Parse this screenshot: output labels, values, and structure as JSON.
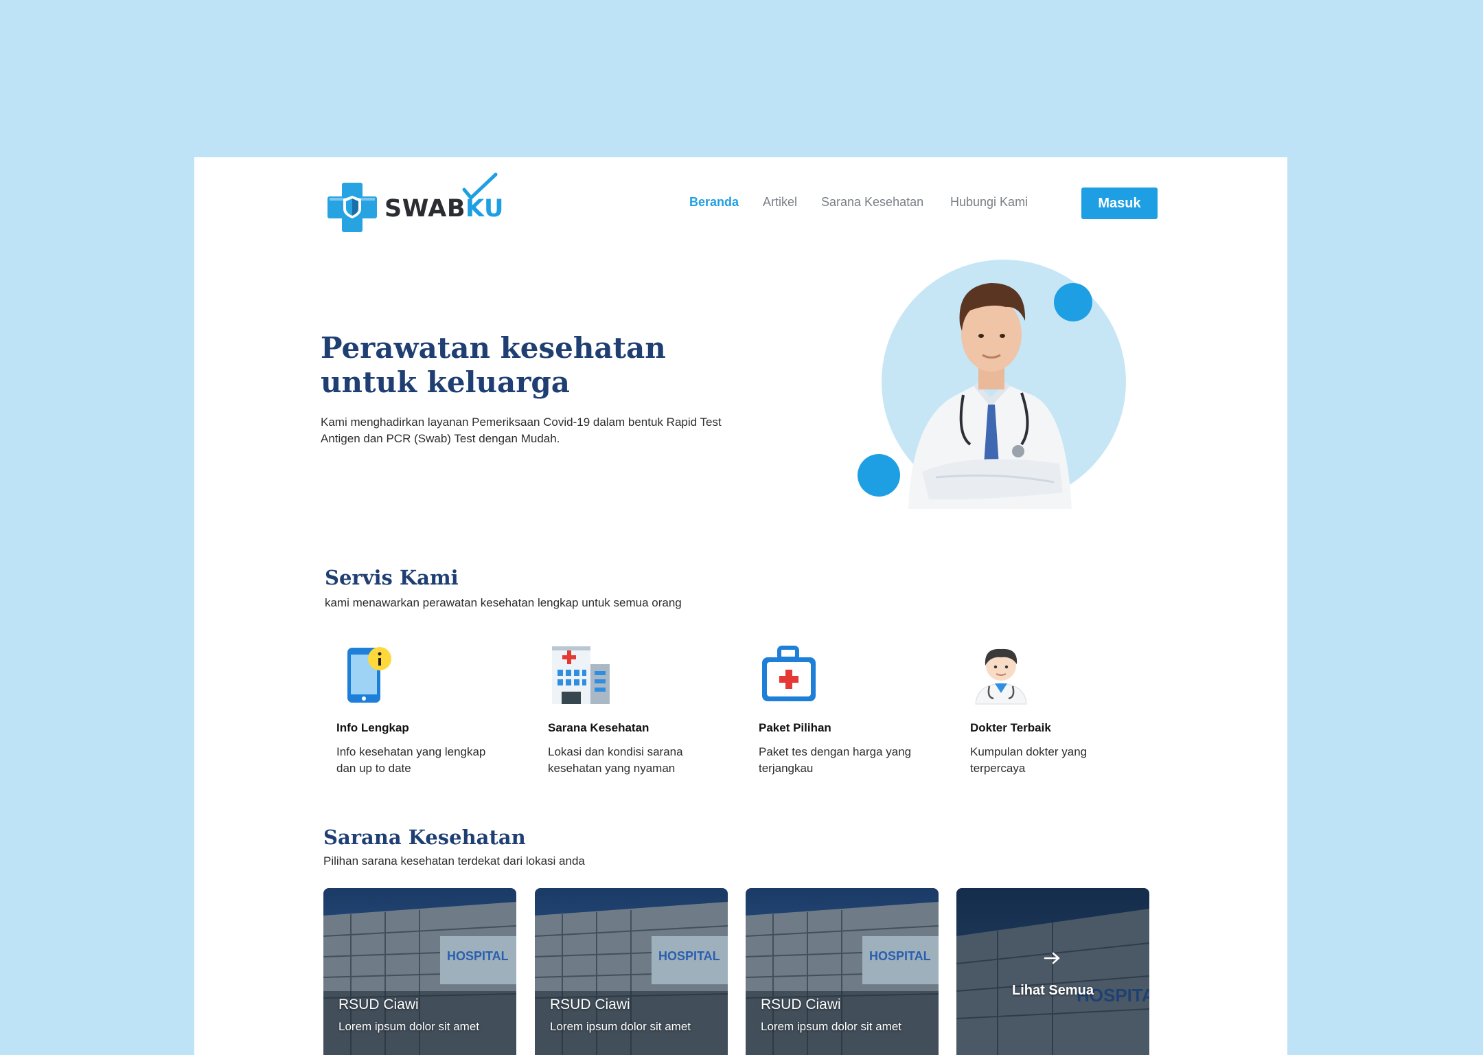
{
  "brand": {
    "name_part1": "SWAB",
    "name_part2": "KU"
  },
  "nav": {
    "items": [
      "Beranda",
      "Artikel",
      "Sarana Kesehatan",
      "Hubungi Kami"
    ],
    "active": "Beranda",
    "login_label": "Masuk"
  },
  "hero": {
    "title": "Perawatan kesehatan untuk keluarga",
    "description": "Kami menghadirkan layanan Pemeriksaan Covid-19 dalam bentuk Rapid Test Antigen dan PCR (Swab) Test dengan Mudah."
  },
  "services": {
    "title": "Servis Kami",
    "subtitle": "kami menawarkan perawatan kesehatan lengkap untuk semua orang",
    "items": [
      {
        "icon": "phone-info-icon",
        "title": "Info Lengkap",
        "desc": "Info kesehatan yang lengkap dan up to date"
      },
      {
        "icon": "hospital-building-icon",
        "title": "Sarana Kesehatan",
        "desc": "Lokasi dan kondisi sarana kesehatan yang nyaman"
      },
      {
        "icon": "medical-kit-icon",
        "title": "Paket Pilihan",
        "desc": "Paket tes dengan harga yang terjangkau"
      },
      {
        "icon": "doctor-icon",
        "title": "Dokter Terbaik",
        "desc": "Kumpulan dokter yang terpercaya"
      }
    ]
  },
  "facilities": {
    "title": "Sarana Kesehatan",
    "subtitle": "Pilihan sarana kesehatan terdekat dari lokasi anda",
    "cards": [
      {
        "name": "RSUD Ciawi",
        "desc": "Lorem ipsum dolor sit amet"
      },
      {
        "name": "RSUD Ciawi",
        "desc": "Lorem ipsum dolor sit amet"
      },
      {
        "name": "RSUD Ciawi",
        "desc": "Lorem ipsum dolor sit amet"
      }
    ],
    "see_all_label": "Lihat Semua",
    "building_sign": "HOSPITAL",
    "building_sign_cropped": "HOSPITA"
  },
  "colors": {
    "accent": "#1e9fe3",
    "heading": "#1f3f73",
    "background": "#bfe3f6",
    "hero_circle": "#c6e6f6"
  }
}
